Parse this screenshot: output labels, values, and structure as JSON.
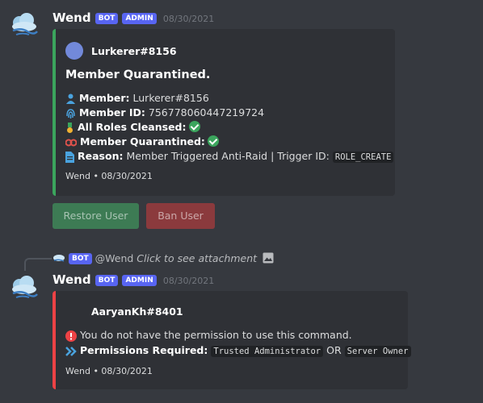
{
  "colors": {
    "background": "#36393f",
    "embed_bg": "#2f3136",
    "success": "#3ba55d",
    "danger": "#ed4245",
    "accent": "#5865f2"
  },
  "message1": {
    "author": "Wend",
    "bot_tag": "BOT",
    "admin_tag": "ADMIN",
    "timestamp": "08/30/2021",
    "avatar_icon": "cloud-icon",
    "embed": {
      "author_name": "Lurkerer#8156",
      "title": "Member Quarantined.",
      "fields": [
        {
          "icon": "user-icon",
          "label": "Member:",
          "value": "Lurkerer#8156"
        },
        {
          "icon": "fingerprint-icon",
          "label": "Member ID:",
          "value": "756778060447219724"
        },
        {
          "icon": "medal-icon",
          "label": "All Roles Cleansed:",
          "value": "check"
        },
        {
          "icon": "shackles-icon",
          "label": "Member Quarantined:",
          "value": "check"
        },
        {
          "icon": "document-icon",
          "label": "Reason:",
          "value": "Member Triggered Anti-Raid | Trigger ID:",
          "code": "ROLE_CREATE"
        }
      ],
      "footer": "Wend • 08/30/2021"
    },
    "buttons": {
      "restore": "Restore User",
      "ban": "Ban User"
    }
  },
  "message2": {
    "reply": {
      "bot_tag": "BOT",
      "mention": "@Wend",
      "text": "Click to see attachment"
    },
    "author": "Wend",
    "bot_tag": "BOT",
    "admin_tag": "ADMIN",
    "timestamp": "08/30/2021",
    "embed": {
      "author_name": "AaryanKh#8401",
      "error_text": "You do not have the permission to use this command.",
      "perm_label": "Permissions Required:",
      "perm_a": "Trusted Administrator",
      "perm_or": "OR",
      "perm_b": "Server Owner",
      "footer": "Wend • 08/30/2021"
    }
  }
}
